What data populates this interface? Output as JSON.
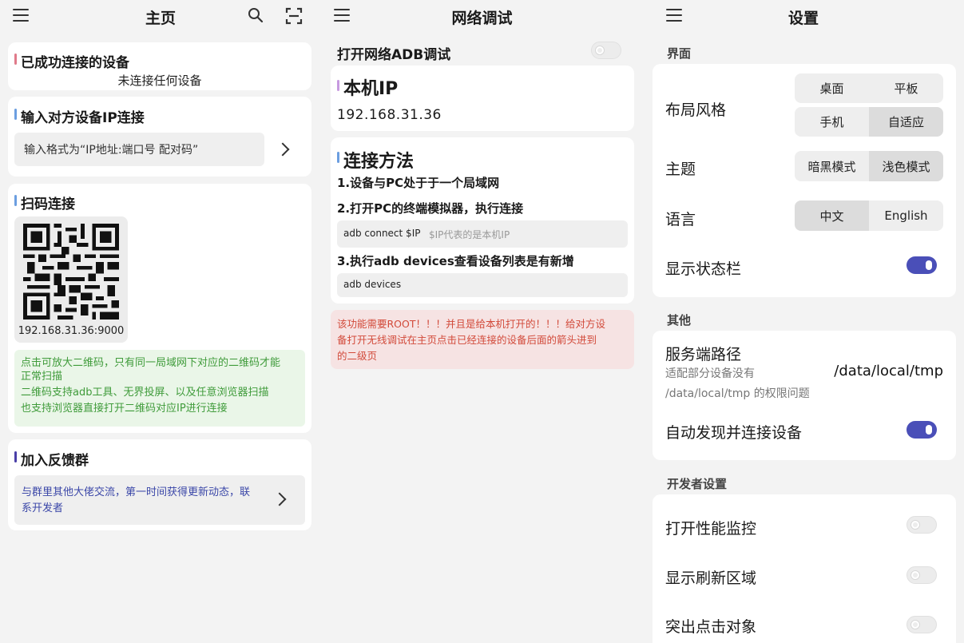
{
  "home": {
    "title": "主页",
    "connected_title": "已成功连接的设备",
    "connected_status": "未连接任何设备",
    "ip_connect_title": "输入对方设备IP连接",
    "ip_input_placeholder": "输入格式为“IP地址:端口号 配对码”",
    "qr_title": "扫码连接",
    "qr_address": "192.168.31.36:9000",
    "qr_tips": [
      "点击可放大二维码，只有同一局域网下对应的二维码才能",
      "正常扫描",
      "二维码支持adb工具、无界投屏、以及任意浏览器扫描",
      "也支持浏览器直接打开二维码对应IP进行连接"
    ],
    "feedback_title": "加入反馈群",
    "feedback_text_1": "与群里其他大佬交流，第一时间获得更新动态，联",
    "feedback_text_2": "系开发者",
    "icons": [
      "menu-icon",
      "search-icon",
      "scan-icon",
      "chevron-right-icon"
    ]
  },
  "network": {
    "title": "网络调试",
    "adb_toggle_label": "打开网络ADB调试",
    "local_ip_title": "本机IP",
    "local_ip": "192.168.31.36",
    "method_title": "连接方法",
    "step1": "1.设备与PC处于于一个局域网",
    "step2": "2.打开PC的终端模拟器，执行连接",
    "cmd1": "adb connect $IP",
    "cmd1_hint": "$IP代表的是本机IP",
    "step3": "3.执行adb devices查看设备列表是有新增",
    "cmd2": "adb devices",
    "warning_1": "该功能需要ROOT！！！并且是给本机打开的！！！给对方设",
    "warning_2": "备打开无线调试在主页点击已经连接的设备后面的箭头进到",
    "warning_3": "的二级页"
  },
  "settings": {
    "title": "设置",
    "group_ui": "界面",
    "layout_label": "布局风格",
    "layout_options": [
      "桌面",
      "平板",
      "手机",
      "自适应"
    ],
    "layout_selected": "自适应",
    "theme_label": "主题",
    "theme_options": [
      "暗黑模式",
      "浅色模式"
    ],
    "theme_selected": "浅色模式",
    "language_label": "语言",
    "language_options": [
      "中文",
      "English"
    ],
    "language_selected": "中文",
    "statusbar_label": "显示状态栏",
    "statusbar_on": true,
    "group_other": "其他",
    "server_path_label": "服务端路径",
    "server_path_desc_1": "适配部分设备没有",
    "server_path_desc_2": "/data/local/tmp 的权限问题",
    "server_path_value": "/data/local/tmp",
    "auto_connect_label": "自动发现并连接设备",
    "auto_connect_on": true,
    "group_dev": "开发者设置",
    "perf_monitor_label": "打开性能监控",
    "show_refresh_label": "显示刷新区域",
    "highlight_click_label": "突出点击对象"
  },
  "colors": {
    "accent": "#4a4fb8",
    "tip_green_bg": "#eaf6e8",
    "tip_green_text": "#3f9b3a",
    "warn_bg": "#f6e3e3",
    "warn_text": "#d24a3a",
    "feedback_text": "#3b47a8"
  }
}
